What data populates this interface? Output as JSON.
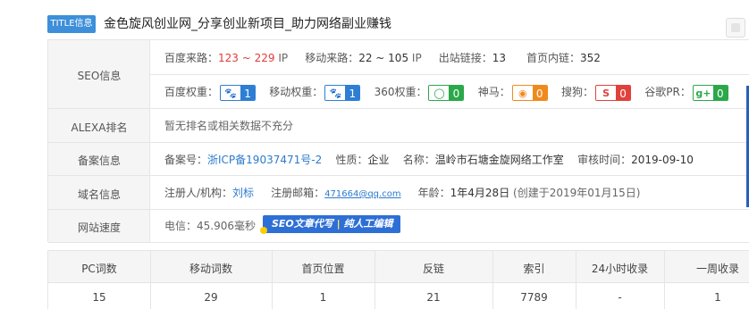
{
  "header": {
    "badge": "TITLE信息",
    "title": "金色旋风创业网_分享创业新项目_助力网络副业赚钱"
  },
  "labels": {
    "seo": "SEO信息",
    "alexa": "ALEXA排名",
    "icp": "备案信息",
    "domain": "域名信息",
    "speed": "网站速度"
  },
  "seo": {
    "baidu_source_key": "百度来路：",
    "baidu_source_val": "123 ~ 229",
    "baidu_source_unit": "IP",
    "mobile_source_key": "移动来路：",
    "mobile_source_val": "22 ~ 105",
    "mobile_source_unit": "IP",
    "outlinks_key": "出站链接：",
    "outlinks_val": "13",
    "inlinks_key": "首页内链：",
    "inlinks_val": "352",
    "weights": [
      {
        "label": "百度权重：",
        "value": "1",
        "icon": "paw-icon"
      },
      {
        "label": "移动权重：",
        "value": "1",
        "icon": "paw-icon"
      },
      {
        "label": "360权重：",
        "value": "0",
        "icon": "360-icon"
      },
      {
        "label": "神马：",
        "value": "0",
        "icon": "shenma-icon"
      },
      {
        "label": "搜狗：",
        "value": "0",
        "icon": "sogou-icon"
      },
      {
        "label": "谷歌PR：",
        "value": "0",
        "icon": "google-plus-icon"
      }
    ]
  },
  "alexa": {
    "text": "暂无排名或相关数据不充分"
  },
  "icp": {
    "number_key": "备案号：",
    "number_val": "浙ICP备19037471号-2",
    "nature_key": "性质：",
    "nature_val": "企业",
    "name_key": "名称：",
    "name_val": "温岭市石塘金旋网络工作室",
    "date_key": "审核时间：",
    "date_val": "2019-09-10"
  },
  "domain": {
    "registrant_key": "注册人/机构：",
    "registrant_val": "刘标",
    "email_key": "注册邮箱：",
    "email_val": "471664@qq.com",
    "age_key": "年龄：",
    "age_val": "1年4月28日",
    "created": "(创建于2019年01月15日)"
  },
  "speed": {
    "text": "电信：45.906毫秒",
    "ad_left": "SEO文章代写",
    "ad_sep": "|",
    "ad_right": "纯人工编辑"
  },
  "stats": {
    "headers": [
      "PC词数",
      "移动词数",
      "首页位置",
      "反链",
      "索引",
      "24小时收录",
      "一周收录"
    ],
    "values": [
      "15",
      "29",
      "1",
      "21",
      "7789",
      "-",
      "1"
    ]
  },
  "colors": {
    "accent": "#3d8fd9",
    "red": "#e23b3b",
    "link": "#2b7bcc",
    "label_bg": "#f5f5f5",
    "border": "#e5e5e5"
  }
}
